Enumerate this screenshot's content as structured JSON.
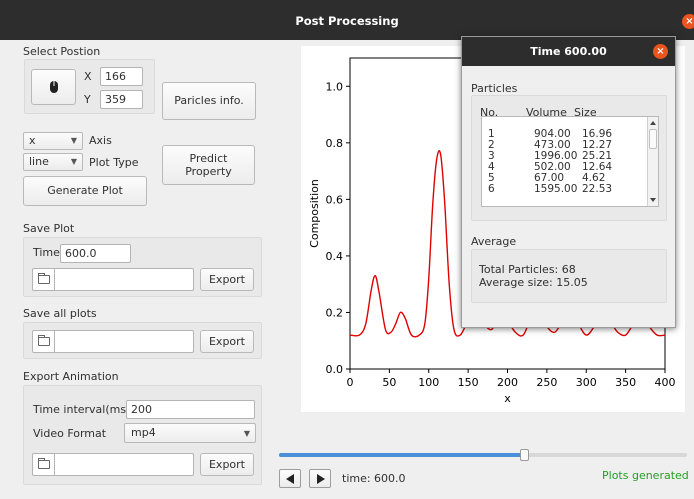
{
  "window": {
    "title": "Post Processing",
    "close_icon": "×"
  },
  "select_position": {
    "heading": "Select Postion",
    "x_label": "X",
    "x_value": "166",
    "y_label": "Y",
    "y_value": "359",
    "particles_info_button": "Paricles info."
  },
  "plot_controls": {
    "axis_value": "x",
    "axis_label": "Axis",
    "plot_type_value": "line",
    "plot_type_label": "Plot Type",
    "predict_line1": "Predict",
    "predict_line2": "Property",
    "generate_button": "Generate Plot"
  },
  "save_plot": {
    "heading": "Save Plot",
    "time_label": "Time",
    "time_value": "600.0",
    "path_value": "",
    "export_button": "Export"
  },
  "save_all_plots": {
    "heading": "Save all plots",
    "path_value": "",
    "export_button": "Export"
  },
  "export_animation": {
    "heading": "Export Animation",
    "interval_label": "Time interval(ms)",
    "interval_value": "200",
    "format_label": "Video Format",
    "format_value": "mp4",
    "path_value": "",
    "export_button": "Export"
  },
  "timeline": {
    "progress": 0.6,
    "time_text": "time: 600.0",
    "status_text": "Plots generated",
    "status_color": "#22a022"
  },
  "chart_data": {
    "type": "line",
    "xlabel": "x",
    "ylabel": "Composition",
    "xlim": [
      0,
      400
    ],
    "ylim": [
      0,
      1.1
    ],
    "xticks": [
      "0",
      "50",
      "100",
      "150",
      "200",
      "250",
      "300",
      "350",
      "400"
    ],
    "yticks": [
      "0.0",
      "0.2",
      "0.4",
      "0.6",
      "0.8",
      "1.0"
    ],
    "series": [
      {
        "color": "#e00000",
        "x": [
          0,
          12,
          20,
          27,
          32,
          37,
          45,
          52,
          58,
          64,
          70,
          78,
          88,
          95,
          100,
          105,
          110,
          115,
          120,
          126,
          132,
          140,
          150,
          160,
          170,
          180,
          190,
          200,
          210,
          220,
          230,
          240,
          250,
          260,
          270,
          280,
          290,
          300,
          310,
          320,
          330,
          340,
          350,
          360,
          370,
          380,
          390,
          400
        ],
        "y": [
          0.12,
          0.12,
          0.16,
          0.28,
          0.33,
          0.27,
          0.14,
          0.13,
          0.16,
          0.2,
          0.18,
          0.12,
          0.12,
          0.16,
          0.32,
          0.58,
          0.74,
          0.76,
          0.6,
          0.3,
          0.14,
          0.12,
          0.17,
          0.2,
          0.16,
          0.14,
          0.19,
          0.17,
          0.13,
          0.12,
          0.18,
          0.2,
          0.15,
          0.13,
          0.17,
          0.21,
          0.16,
          0.12,
          0.15,
          0.2,
          0.17,
          0.13,
          0.12,
          0.16,
          0.19,
          0.15,
          0.12,
          0.12
        ]
      }
    ],
    "grid": false
  },
  "particles_popup": {
    "title": "Time 600.00",
    "particles_heading": "Particles",
    "columns": [
      "No.",
      "Volume",
      "Size"
    ],
    "rows": [
      {
        "no": "1",
        "volume": "904.00",
        "size": "16.96"
      },
      {
        "no": "2",
        "volume": "473.00",
        "size": "12.27"
      },
      {
        "no": "3",
        "volume": "1996.00",
        "size": "25.21"
      },
      {
        "no": "4",
        "volume": "502.00",
        "size": "12.64"
      },
      {
        "no": "5",
        "volume": "67.00",
        "size": "4.62"
      },
      {
        "no": "6",
        "volume": "1595.00",
        "size": "22.53"
      }
    ],
    "average_heading": "Average",
    "total_particles": "Total Particles: 68",
    "average_size": "Average size: 15.05"
  }
}
